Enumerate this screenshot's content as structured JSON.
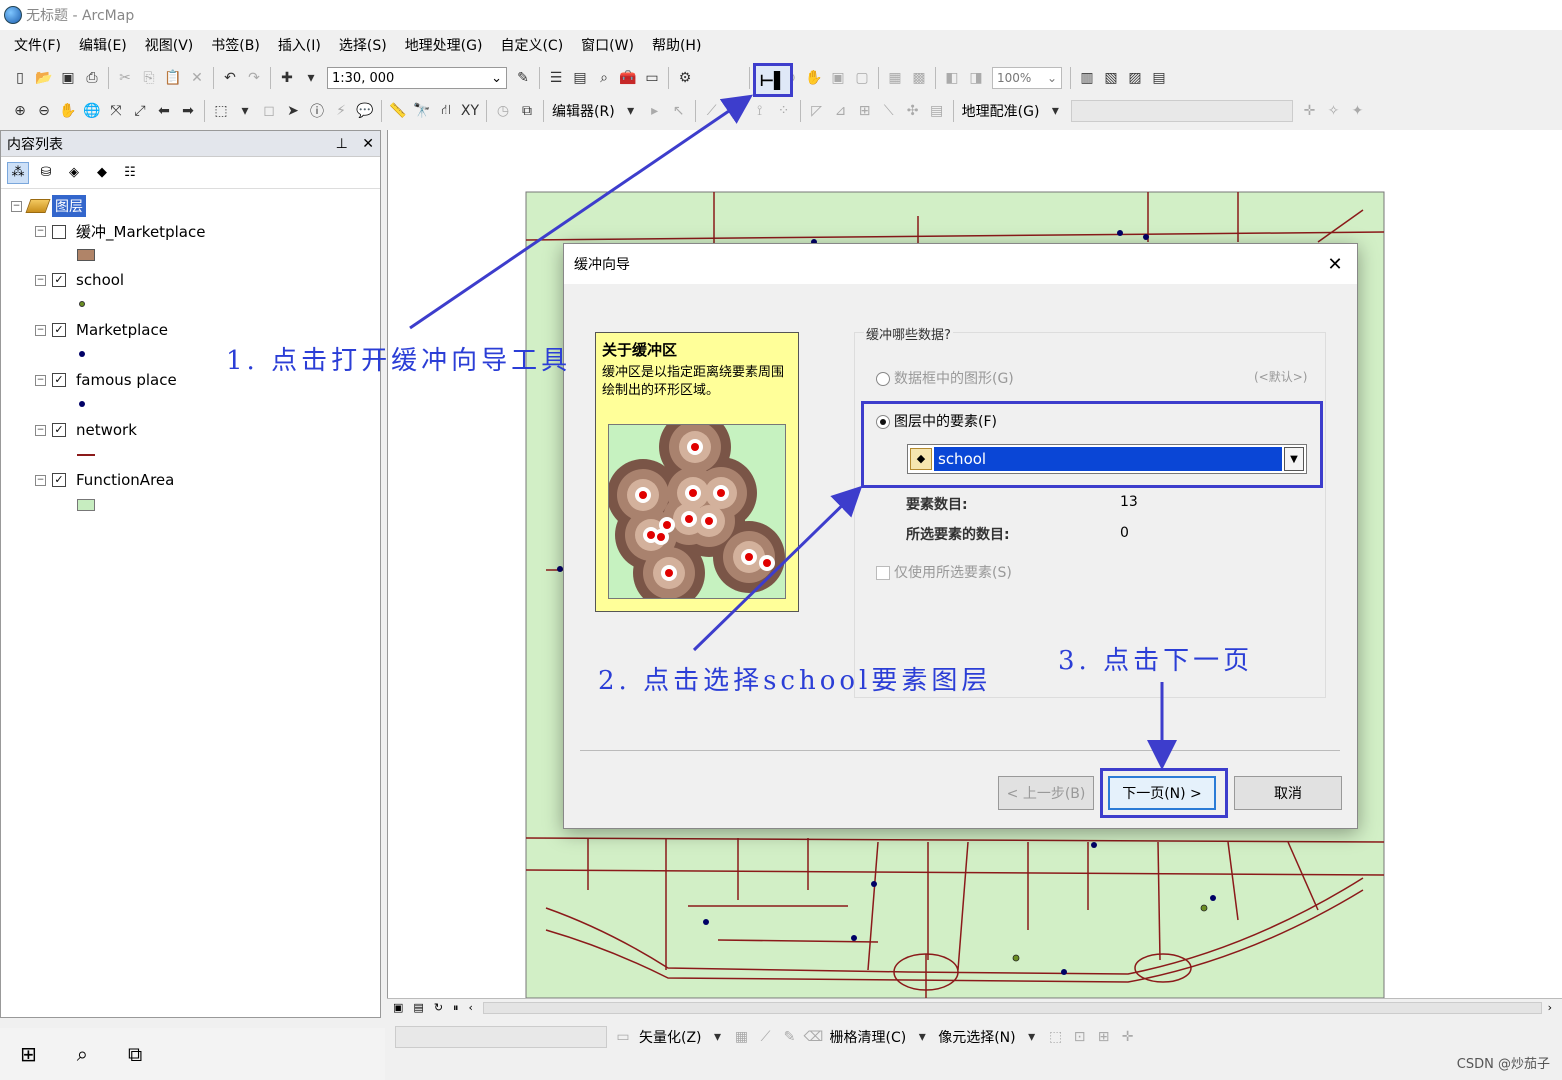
{
  "window": {
    "title": "无标题 - ArcMap"
  },
  "menubar": [
    {
      "label": "文件(F)"
    },
    {
      "label": "编辑(E)"
    },
    {
      "label": "视图(V)"
    },
    {
      "label": "书签(B)"
    },
    {
      "label": "插入(I)"
    },
    {
      "label": "选择(S)"
    },
    {
      "label": "地理处理(G)"
    },
    {
      "label": "自定义(C)"
    },
    {
      "label": "窗口(W)"
    },
    {
      "label": "帮助(H)"
    }
  ],
  "toolbar": {
    "scale": "1:30, 000",
    "zoom": "100%",
    "editor_label": "编辑器(R)",
    "georef_label": "地理配准(G)",
    "buffer_tool_glyph": "⊢▌"
  },
  "toc": {
    "title": "内容列表",
    "root": "图层",
    "layers": [
      {
        "name": "缓冲_Marketplace",
        "checked": false,
        "symbol": "fill",
        "color": "#b08468"
      },
      {
        "name": "school",
        "checked": true,
        "symbol": "point",
        "color": "#6b8e23"
      },
      {
        "name": "Marketplace",
        "checked": true,
        "symbol": "point",
        "color": "#000066"
      },
      {
        "name": "famous place",
        "checked": true,
        "symbol": "point",
        "color": "#000066"
      },
      {
        "name": "network",
        "checked": true,
        "symbol": "line",
        "color": "#8b1a1a"
      },
      {
        "name": "FunctionArea",
        "checked": true,
        "symbol": "fill",
        "color": "#c7edc0"
      }
    ]
  },
  "dialog": {
    "title": "缓冲向导",
    "info_title": "关于缓冲区",
    "info_desc": "缓冲区是以指定距离绕要素周围绘制出的环形区域。",
    "question": "缓冲哪些数据?",
    "option_graphics": "数据框中的图形(G)",
    "default_tag": "(<默认>)",
    "option_layer": "图层中的要素(F)",
    "selected_layer": "school",
    "feature_count_label": "要素数目:",
    "feature_count": "13",
    "selected_count_label": "所选要素的数目:",
    "selected_count": "0",
    "only_selected": "仅使用所选要素(S)",
    "btn_prev": "< 上一步(B)",
    "btn_next": "下一页(N) >",
    "btn_cancel": "取消"
  },
  "annotations": {
    "step1": "1. 点击打开缓冲向导工具",
    "step2": "2. 点击选择school要素图层",
    "step3": "3. 点击下一页"
  },
  "bottombar": {
    "vectorize": "矢量化(Z)",
    "raster_clean": "栅格清理(C)",
    "pixel_select": "像元选择(N)"
  },
  "watermark": "CSDN @炒茄子",
  "colors": {
    "accent": "#3d3dcc",
    "map_green": "#d2efc6",
    "road": "#8b1a1a"
  }
}
